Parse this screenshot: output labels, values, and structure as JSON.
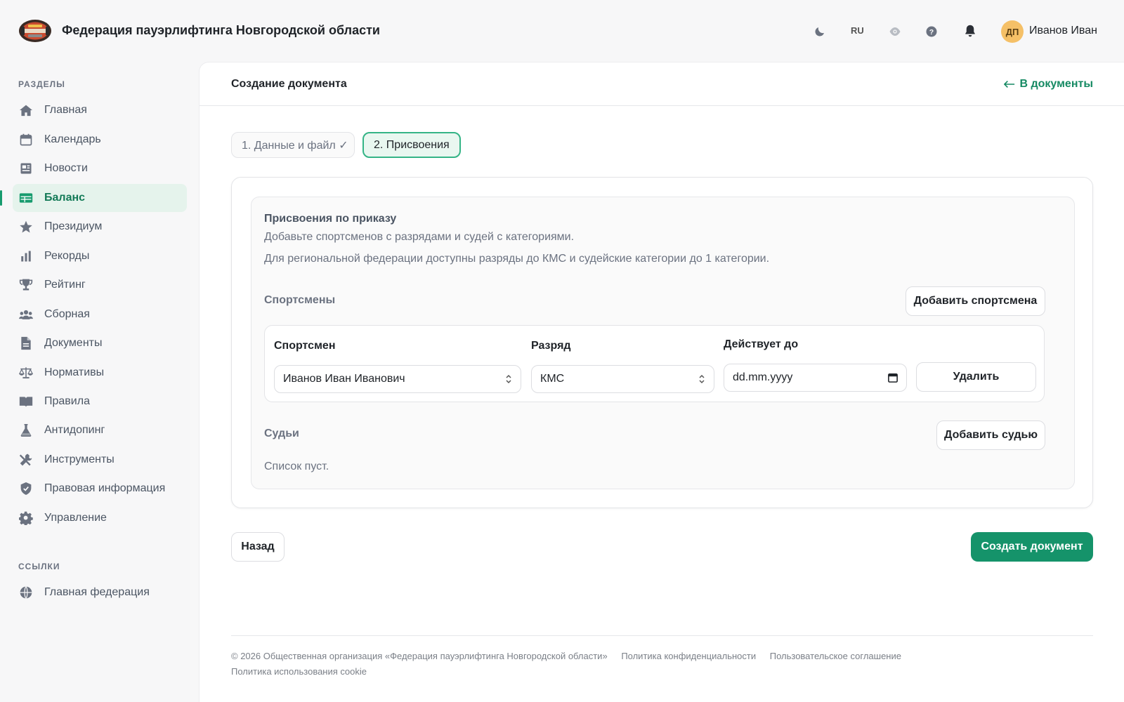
{
  "header": {
    "site_title": "Федерация пауэрлифтинга Новгородской области",
    "lang": "RU",
    "avatar_initials": "ДП",
    "user_name": "Иванов Иван",
    "icons": [
      "moon-icon",
      "eye-icon",
      "help-icon",
      "bell-icon"
    ]
  },
  "sidebar": {
    "sections_title": "РАЗДЕЛЫ",
    "items": [
      {
        "label": "Главная",
        "icon": "home-icon"
      },
      {
        "label": "Календарь",
        "icon": "calendar-icon"
      },
      {
        "label": "Новости",
        "icon": "news-icon"
      },
      {
        "label": "Баланс",
        "icon": "table-icon",
        "active": true
      },
      {
        "label": "Президиум",
        "icon": "star-icon"
      },
      {
        "label": "Рекорды",
        "icon": "bar-chart-icon"
      },
      {
        "label": "Рейтинг",
        "icon": "trophy-icon"
      },
      {
        "label": "Сборная",
        "icon": "team-icon"
      },
      {
        "label": "Документы",
        "icon": "document-icon"
      },
      {
        "label": "Нормативы",
        "icon": "scales-icon"
      },
      {
        "label": "Правила",
        "icon": "book-icon"
      },
      {
        "label": "Антидопинг",
        "icon": "flask-icon"
      },
      {
        "label": "Инструменты",
        "icon": "tools-icon"
      },
      {
        "label": "Правовая информация",
        "icon": "shield-icon"
      },
      {
        "label": "Управление",
        "icon": "gear-icon"
      }
    ],
    "links_title": "ССЫЛКИ",
    "links": [
      {
        "label": "Главная федерация",
        "icon": "globe-icon"
      }
    ]
  },
  "main": {
    "page_title": "Создание документа",
    "back_link": "В документы",
    "steps": [
      {
        "label": "1. Данные и файл ✓",
        "state": "done"
      },
      {
        "label": "2. Присвоения",
        "state": "current"
      }
    ],
    "card": {
      "title": "Присвоения по приказу",
      "desc1": "Добавьте спортсменов с разрядами и судей с категориями.",
      "desc2": "Для региональной федерации доступны разряды до КМС и судейские категории до 1 категории.",
      "athletes_heading": "Спортсмены",
      "add_athlete": "Добавить спортсмена",
      "athlete_row": {
        "athlete_label": "Спортсмен",
        "athlete_value": "Иванов Иван Иванович",
        "rank_label": "Разряд",
        "rank_value": "КМС",
        "valid_label": "Действует до",
        "valid_placeholder": "dd.mm.yyyy",
        "delete": "Удалить"
      },
      "judges_heading": "Судьи",
      "add_judge": "Добавить судью",
      "empty": "Список пуст."
    },
    "back_button": "Назад",
    "create_button": "Создать документ"
  },
  "footer": {
    "copyright": "© 2026 Общественная организация «Федерация пауэрлифтинга Новгородской области»",
    "privacy": "Политика конфиденциальности",
    "terms": "Пользовательское соглашение",
    "cookie": "Политика использования cookie"
  },
  "colors": {
    "accent": "#15936a",
    "accent_light": "#e5f3ec",
    "text": "#1f2328",
    "muted": "#6b7280"
  }
}
